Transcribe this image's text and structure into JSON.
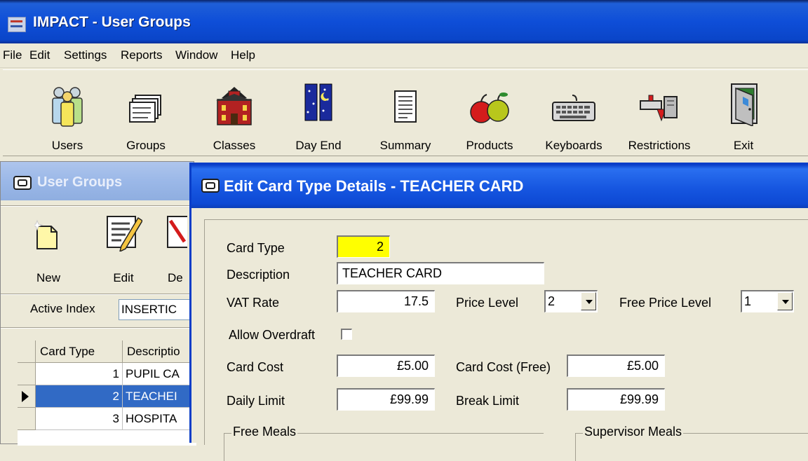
{
  "app": {
    "title": "IMPACT - User Groups",
    "menu": [
      "File",
      "Edit",
      "Settings",
      "Reports",
      "Window",
      "Help"
    ],
    "toolbar": [
      "Users",
      "Groups",
      "Classes",
      "Day End",
      "Summary",
      "Products",
      "Keyboards",
      "Restrictions",
      "Exit"
    ]
  },
  "user_groups": {
    "title": "User Groups",
    "tools": [
      "New",
      "Edit",
      "De"
    ],
    "active_index_label": "Active Index",
    "active_index_value": "INSERTIC",
    "grid": {
      "headers": [
        "Card Type",
        "Descriptio"
      ],
      "rows": [
        {
          "card_type": "1",
          "description": "PUPIL CA"
        },
        {
          "card_type": "2",
          "description": "TEACHEI"
        },
        {
          "card_type": "3",
          "description": "HOSPITA"
        }
      ],
      "selected_row": 1
    }
  },
  "edit_dialog": {
    "title": "Edit Card Type Details - TEACHER CARD",
    "card_type_label": "Card Type",
    "card_type_value": "2",
    "description_label": "Description",
    "description_value": "TEACHER CARD",
    "vat_rate_label": "VAT Rate",
    "vat_rate_value": "17.5",
    "price_level_label": "Price Level",
    "price_level_value": "2",
    "free_price_level_label": "Free Price Level",
    "free_price_level_value": "1",
    "allow_overdraft_label": "Allow Overdraft",
    "allow_overdraft_checked": false,
    "card_cost_label": "Card Cost",
    "card_cost_value": "£5.00",
    "card_cost_free_label": "Card Cost (Free)",
    "card_cost_free_value": "£5.00",
    "daily_limit_label": "Daily Limit",
    "daily_limit_value": "£99.99",
    "break_limit_label": "Break Limit",
    "break_limit_value": "£99.99",
    "free_meals_label": "Free Meals",
    "supervisor_meals_label": "Supervisor Meals"
  },
  "colors": {
    "title_bar": "#0e4ed8",
    "selection": "#316ac5",
    "highlight_field": "#ffff00",
    "window_bg": "#ece9d8"
  },
  "icons": [
    "users-icon",
    "groups-icon",
    "classes-icon",
    "day-end-icon",
    "summary-icon",
    "products-icon",
    "keyboards-icon",
    "restrictions-icon",
    "exit-icon",
    "new-icon",
    "edit-icon",
    "delete-icon"
  ]
}
